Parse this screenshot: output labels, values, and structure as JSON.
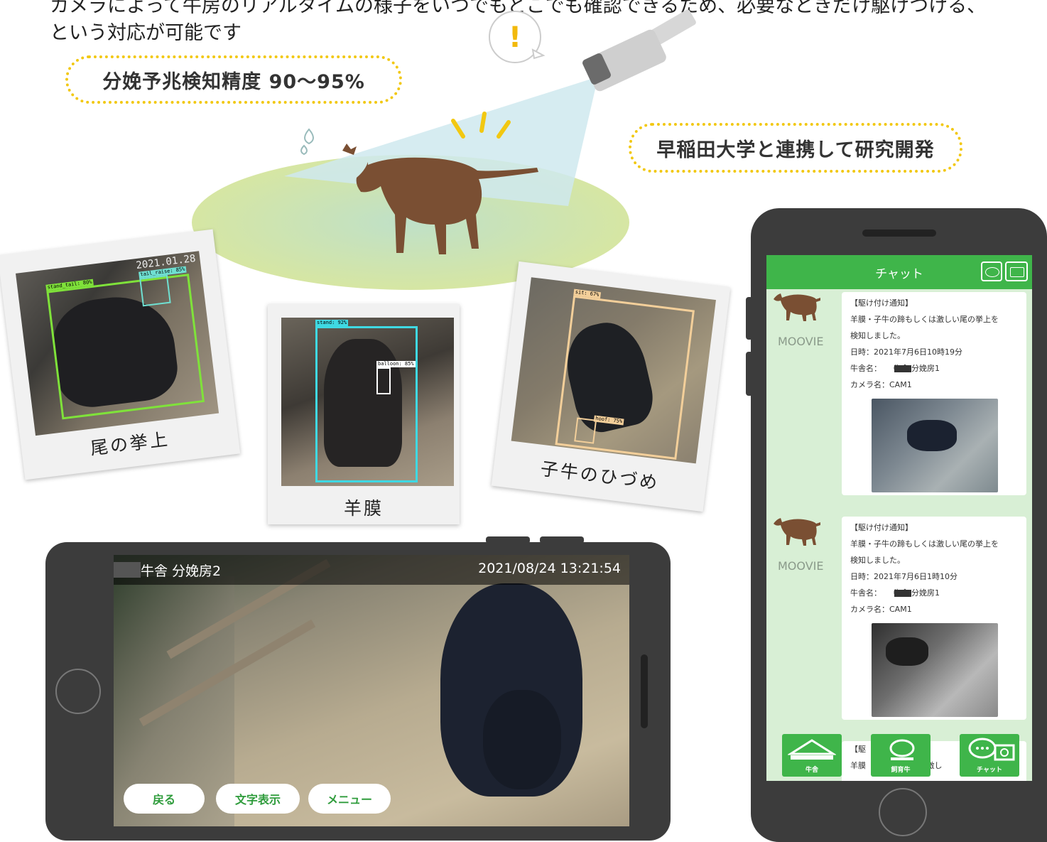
{
  "intro": {
    "line1": "カメラによって牛房のリアルタイムの様子をいつでもどこでも確認できるため、必要なときだけ駆けつける、",
    "line2": "という対応が可能です"
  },
  "badges": {
    "accuracy": "分娩予兆検知精度 90〜95%",
    "research": "早稲田大学と連携して研究開発"
  },
  "alert_mark": "!",
  "photos": [
    {
      "caption": "尾の挙上",
      "stamp": "2021.01.28",
      "tags": [
        "stand_tail: 80%",
        "tail_raise: 85%"
      ]
    },
    {
      "caption": "羊膜",
      "tags": [
        "stand: 92%",
        "balloon: 85%"
      ]
    },
    {
      "caption": "子牛のひづめ",
      "tags": [
        "sit: 67%",
        "hoof: 75%"
      ]
    }
  ],
  "camera_view": {
    "location": "牛舎 分娩房2",
    "datetime": "2021/08/24 13:21:54",
    "buttons": {
      "back": "戻る",
      "text": "文字表示",
      "menu": "メニュー"
    }
  },
  "chat": {
    "title": "チャット",
    "sender": "MOOVIE",
    "messages": [
      {
        "type": "【駆け付け通知】",
        "body1": "羊膜・子牛の蹄もしくは激しい尾の挙上を",
        "body2": "検知しました。",
        "datetime": "日時：2021年7月6日10時19分",
        "barn": "牛舎名：　　牛舎 分娩房1",
        "camera": "カメラ名：CAM1"
      },
      {
        "type": "【駆け付け通知】",
        "body1": "羊膜・子牛の蹄もしくは激しい尾の挙上を",
        "body2": "検知しました。",
        "datetime": "日時：2021年7月6日1時10分",
        "barn": "牛舎名：　　牛舎 分娩房1",
        "camera": "カメラ名：CAM1"
      }
    ],
    "partial": {
      "line1": "【駆",
      "line2": "羊膜",
      "line3": "くは激し"
    },
    "nav": {
      "barn": "牛舎",
      "cattle": "飼育牛",
      "chat": "チャット"
    }
  },
  "colors": {
    "green": "#3fb54a",
    "badge_border": "#f2c811",
    "phone_body": "#3c3c3c",
    "cow": "#7a4f33",
    "chat_bg": "#d8efd5"
  }
}
